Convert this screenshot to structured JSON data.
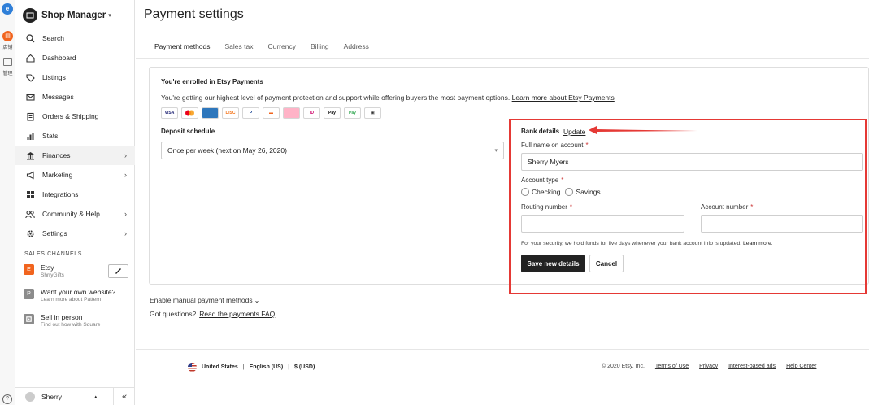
{
  "strip": {
    "store_label": "店铺",
    "manage_label": "管理"
  },
  "sidebar": {
    "shop_title": "Shop Manager",
    "items": [
      {
        "label": "Search"
      },
      {
        "label": "Dashboard"
      },
      {
        "label": "Listings"
      },
      {
        "label": "Messages"
      },
      {
        "label": "Orders & Shipping"
      },
      {
        "label": "Stats"
      },
      {
        "label": "Finances"
      },
      {
        "label": "Marketing"
      },
      {
        "label": "Integrations"
      },
      {
        "label": "Community & Help"
      },
      {
        "label": "Settings"
      }
    ],
    "sales_channels_heading": "SALES CHANNELS",
    "channels": [
      {
        "badge": "E",
        "title": "Etsy",
        "sub": "ShrryGifts",
        "color": "#f1641e"
      },
      {
        "badge": "P",
        "title": "Want your own website?",
        "sub": "Learn more about Pattern",
        "color": "#8c8c8c"
      },
      {
        "badge": "",
        "title": "Sell in person",
        "sub": "Find out how with Square",
        "color": "#8c8c8c"
      }
    ],
    "user_name": "Sherry"
  },
  "main": {
    "page_title": "Payment settings",
    "tabs": [
      {
        "label": "Payment methods"
      },
      {
        "label": "Sales tax"
      },
      {
        "label": "Currency"
      },
      {
        "label": "Billing"
      },
      {
        "label": "Address"
      }
    ],
    "enrolled_title": "You're enrolled in Etsy Payments",
    "description": "You're getting our highest level of payment protection and support while offering buyers the most payment options.",
    "learn_more_link": "Learn more about Etsy Payments",
    "payment_icons": [
      "VISA",
      "MC",
      "AMEX",
      "DISC",
      "PayPal",
      "giftcard",
      "klarna",
      "iDEAL",
      "Pay",
      "Pay",
      "G"
    ],
    "deposit_label": "Deposit schedule",
    "deposit_value": "Once per week (next on May 26, 2020)",
    "bank": {
      "title": "Bank details",
      "update_link": "Update",
      "full_name_label": "Full name on account",
      "full_name_value": "Sherry Myers",
      "account_type_label": "Account type",
      "option_checking": "Checking",
      "option_savings": "Savings",
      "routing_label": "Routing number",
      "account_number_label": "Account number",
      "required_mark": "*",
      "security_text": "For your security, we hold funds for five days whenever your bank account info is updated.",
      "security_link": "Learn more.",
      "save_label": "Save new details",
      "cancel_label": "Cancel"
    },
    "manual_methods": "Enable manual payment methods",
    "questions_text": "Got questions?",
    "faq_link": "Read the payments FAQ"
  },
  "footer": {
    "country": "United States",
    "language": "English (US)",
    "currency": "$ (USD)",
    "copyright": "© 2020 Etsy, Inc.",
    "links": [
      "Terms of Use",
      "Privacy",
      "Interest-based ads",
      "Help Center"
    ]
  },
  "colors": {
    "highlight_border": "#e53935",
    "primary_button": "#222222",
    "etsy_orange": "#f1641e"
  }
}
